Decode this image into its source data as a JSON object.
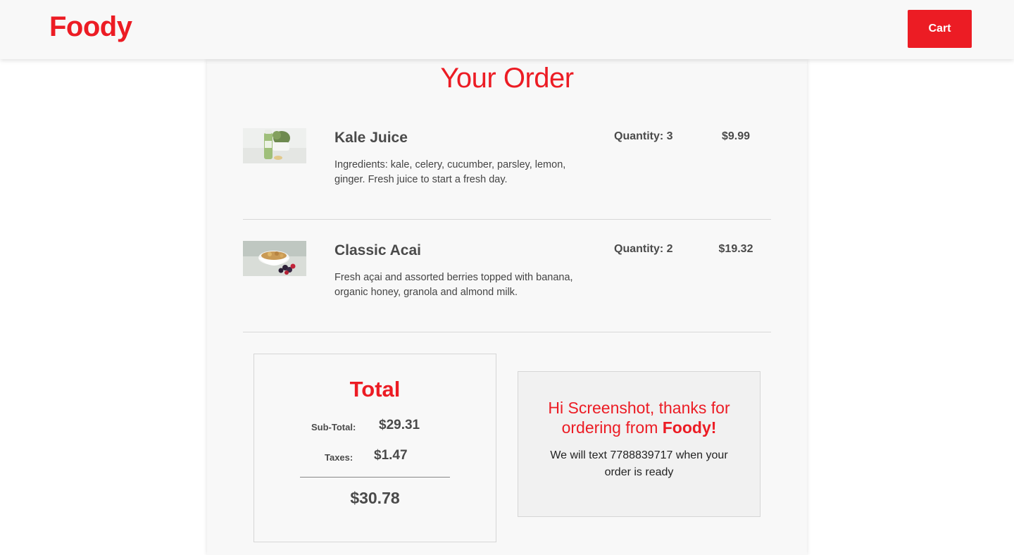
{
  "header": {
    "brand": "Foody",
    "cart_label": "Cart"
  },
  "order": {
    "title": "Your Order",
    "items": [
      {
        "name": "Kale Juice",
        "description": "Ingredients: kale, celery, cucumber, parsley, lemon, ginger. Fresh juice to start a fresh day.",
        "quantity": "Quantity: 3",
        "price": "$9.99",
        "image": "kale-juice-photo"
      },
      {
        "name": "Classic Acai",
        "description": "Fresh açai and assorted berries topped with banana, organic honey, granola and almond milk.",
        "quantity": "Quantity: 2",
        "price": "$19.32",
        "image": "acai-bowl-photo"
      }
    ]
  },
  "totals": {
    "title": "Total",
    "subtotal_label": "Sub-Total:",
    "subtotal_value": "$29.31",
    "taxes_label": "Taxes:",
    "taxes_value": "$1.47",
    "grand_total": "$30.78"
  },
  "thanks": {
    "title_prefix": "Hi Screenshot, thanks for ordering from ",
    "title_brand": "Foody!",
    "message": "We will text 7788839717 when your order is ready"
  },
  "colors": {
    "brand_red": "#ec1c24",
    "card_bg": "#f8f8f8",
    "thanks_bg": "#f1f1f1"
  }
}
